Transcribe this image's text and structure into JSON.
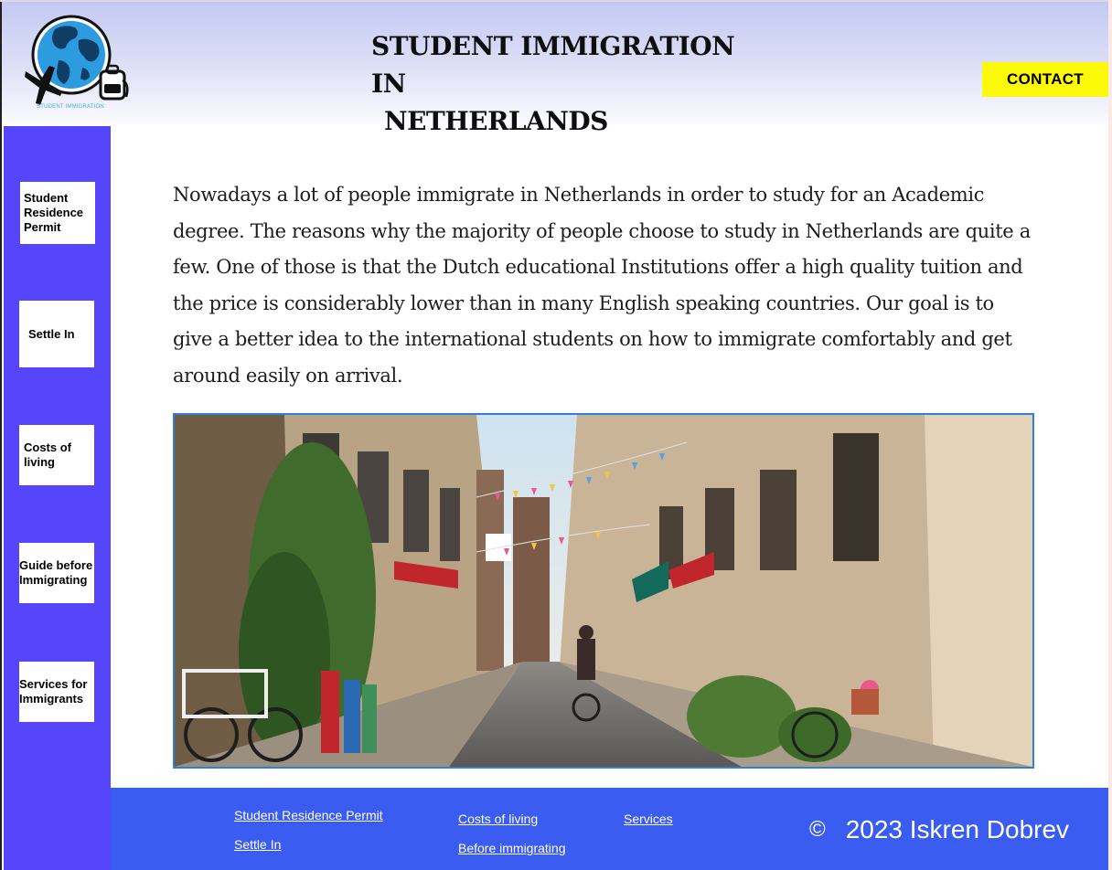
{
  "header": {
    "title_line1": "STUDENT IMMIGRATION IN",
    "title_line2": "NETHERLANDS",
    "logo_caption": "STUDENT IMMIGRATION",
    "contact_label": "CONTACT"
  },
  "sidebar": {
    "items": [
      {
        "label": "Student Residence Permit"
      },
      {
        "label": "Settle In"
      },
      {
        "label": "Costs of living"
      },
      {
        "label": "Guide before Immigrating"
      },
      {
        "label": "Services for Immigrants"
      }
    ]
  },
  "main": {
    "intro_text": "Nowadays a lot of people immigrate in Netherlands in order to study for an Academic degree. The reasons why the majority of people choose to study in Netherlands are quite a few. One of those is that the Dutch educational Institutions offer a high quality tuition and the price is considerably lower than in many English speaking countries.  Our goal is to give a better idea to the international students on how to immigrate comfortably and get around easily on arrival."
  },
  "footer": {
    "links": {
      "student_residence_permit": "Student Residence Permit",
      "settle_in": "Settle In",
      "costs_of_living": "Costs of living",
      "before_immigrating": "Before immigrating",
      "services": "Services"
    },
    "copyright_icon": "©",
    "copyright_text": "2023 Iskren Dobrev"
  },
  "colors": {
    "sidebar": "#5545fb",
    "footer": "#3a5cf0",
    "contact": "#fdf90a",
    "image_border": "#2f80d8"
  }
}
